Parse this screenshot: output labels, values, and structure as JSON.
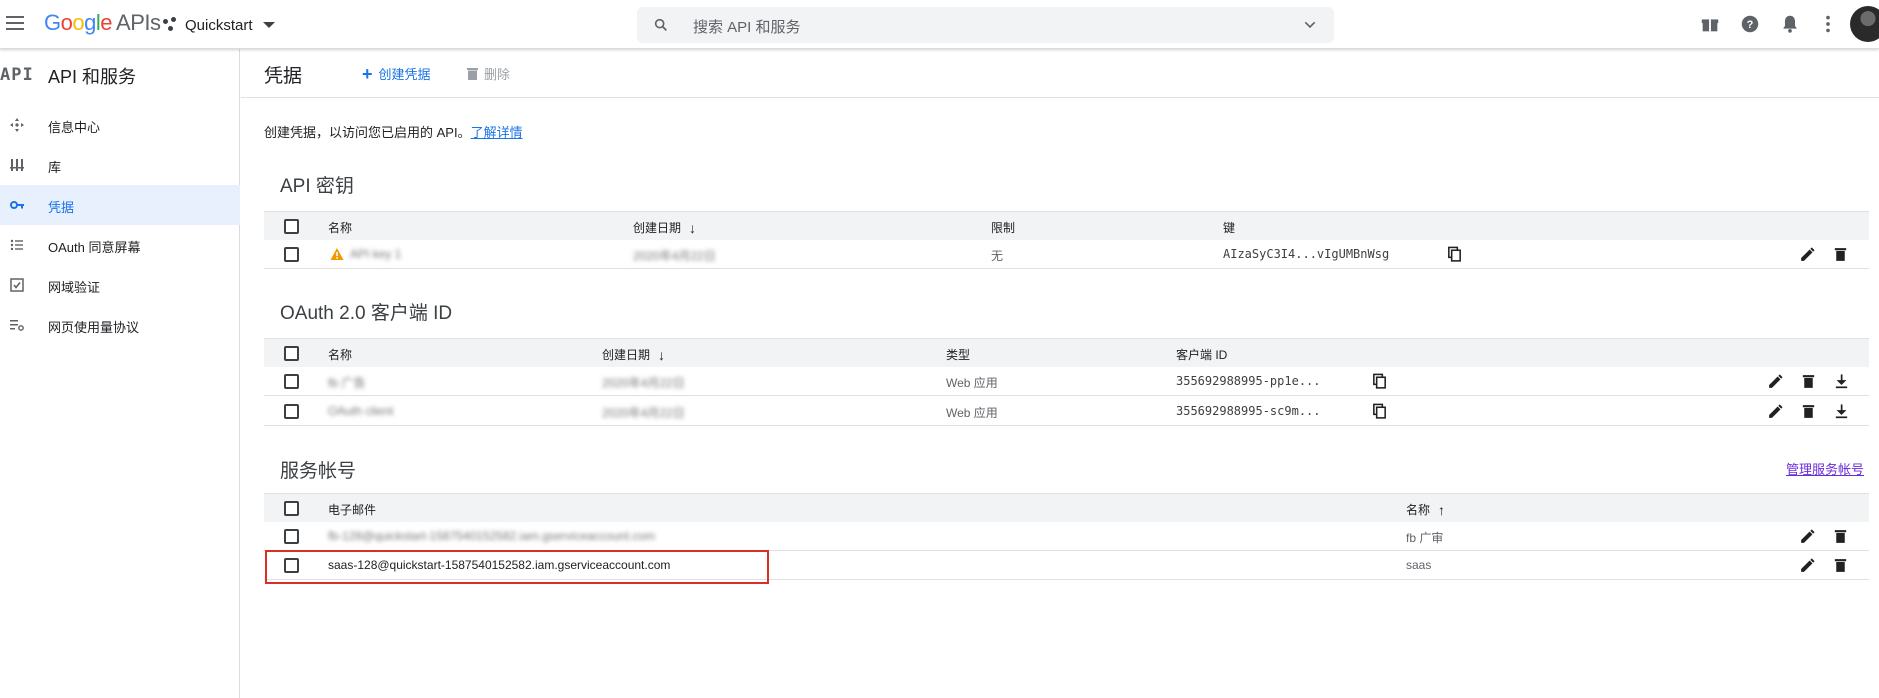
{
  "topbar": {
    "brand": {
      "google": "Google",
      "apis": "APIs"
    },
    "project": "Quickstart",
    "search_placeholder": "搜索 API 和服务"
  },
  "sidebar": {
    "logo": "API",
    "title": "API 和服务",
    "items": [
      {
        "label": "信息中心",
        "icon": "dashboard-icon"
      },
      {
        "label": "库",
        "icon": "library-icon"
      },
      {
        "label": "凭据",
        "icon": "key-icon",
        "active": true
      },
      {
        "label": "OAuth 同意屏幕",
        "icon": "consent-icon"
      },
      {
        "label": "网域验证",
        "icon": "domain-verify-icon"
      },
      {
        "label": "网页使用量协议",
        "icon": "page-usage-icon"
      }
    ]
  },
  "main": {
    "page_title": "凭据",
    "create_label": "创建凭据",
    "delete_label": "删除",
    "intro_text": "创建凭据，以访问您已启用的 API。",
    "learn_more": "了解详情"
  },
  "api_keys": {
    "title": "API 密钥",
    "headers": {
      "name": "名称",
      "created": "创建日期",
      "restrictions": "限制",
      "key": "键"
    },
    "rows": [
      {
        "name": "API key 1",
        "created": "2020年4月22日",
        "restrictions": "无",
        "key": "AIzaSyC3I4...vIgUMBnWsg",
        "warning": true
      }
    ]
  },
  "oauth": {
    "title": "OAuth 2.0 客户端 ID",
    "headers": {
      "name": "名称",
      "created": "创建日期",
      "type": "类型",
      "client_id": "客户端 ID"
    },
    "rows": [
      {
        "name": "fb 广告",
        "created": "2020年4月22日",
        "type": "Web 应用",
        "client_id": "355692988995-pp1e..."
      },
      {
        "name": "OAuth client",
        "created": "2020年4月22日",
        "type": "Web 应用",
        "client_id": "355692988995-sc9m..."
      }
    ]
  },
  "service_accounts": {
    "title": "服务帐号",
    "manage_link": "管理服务帐号",
    "headers": {
      "email": "电子邮件",
      "name": "名称"
    },
    "rows": [
      {
        "email": "fb-128@quickstart-1587540152582.iam.gserviceaccount.com",
        "name": "fb 广审",
        "blurred": true
      },
      {
        "email": "saas-128@quickstart-1587540152582.iam.gserviceaccount.com",
        "name": "saas",
        "blurred": false,
        "highlighted": true
      }
    ]
  },
  "colors": {
    "accent": "#1a73e8",
    "active_bg": "#e8f0fe",
    "highlight": "#d93025",
    "manage_link": "#6c2bd9"
  }
}
